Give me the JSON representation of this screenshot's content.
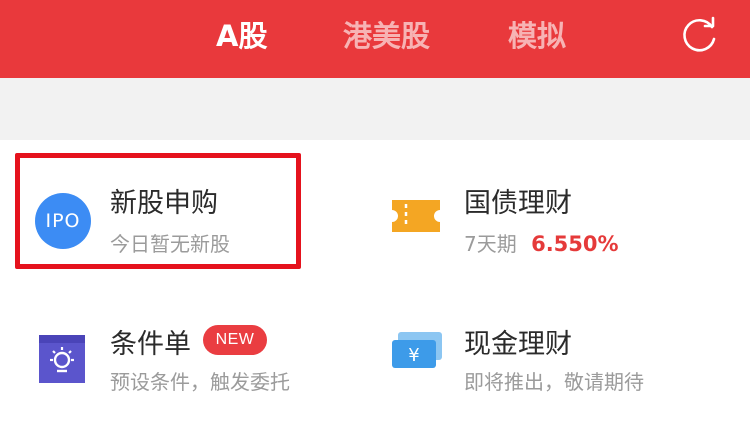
{
  "header": {
    "tabs": [
      {
        "label": "A股",
        "active": true
      },
      {
        "label": "港美股",
        "active": false
      },
      {
        "label": "模拟",
        "active": false
      }
    ],
    "refresh_icon": "refresh-icon",
    "color": "#e9393c"
  },
  "menu": {
    "ipo": {
      "icon_text": "IPO",
      "title": "新股申购",
      "subtitle": "今日暂无新股",
      "highlighted": true
    },
    "bonds": {
      "icon": "ticket-icon",
      "title": "国债理财",
      "period": "7天期",
      "rate": "6.550%"
    },
    "conditional_order": {
      "icon": "bulb-card-icon",
      "title": "条件单",
      "badge": "NEW",
      "subtitle": "预设条件，触发委托"
    },
    "cash": {
      "icon": "yen-card-icon",
      "title": "现金理财",
      "subtitle": "即将推出，敬请期待"
    }
  }
}
